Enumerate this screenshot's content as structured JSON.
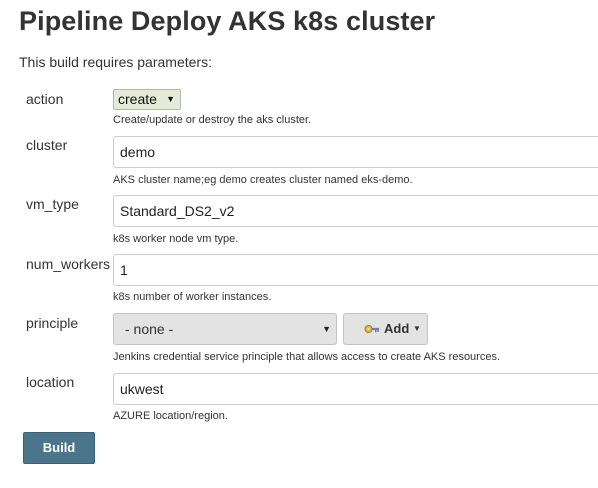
{
  "page": {
    "title": "Pipeline Deploy AKS k8s cluster",
    "intro": "This build requires parameters:"
  },
  "params": {
    "action": {
      "label": "action",
      "value": "create",
      "description": "Create/update or destroy the aks cluster."
    },
    "cluster": {
      "label": "cluster",
      "value": "demo",
      "description": "AKS cluster name;eg demo creates cluster named eks-demo."
    },
    "vm_type": {
      "label": "vm_type",
      "value": "Standard_DS2_v2",
      "description": "k8s worker node vm type."
    },
    "num_workers": {
      "label": "num_workers",
      "value": "1",
      "description": "k8s number of worker instances."
    },
    "principle": {
      "label": "principle",
      "value": "- none -",
      "add_label": "Add",
      "description": "Jenkins credential service principle that allows access to create AKS resources."
    },
    "location": {
      "label": "location",
      "value": "ukwest",
      "description": "AZURE location/region."
    }
  },
  "actions": {
    "build_label": "Build"
  },
  "colors": {
    "build_button": "#4b758b",
    "action_select_bg": "#e4ecd8",
    "control_gray": "#e3e3e3"
  }
}
